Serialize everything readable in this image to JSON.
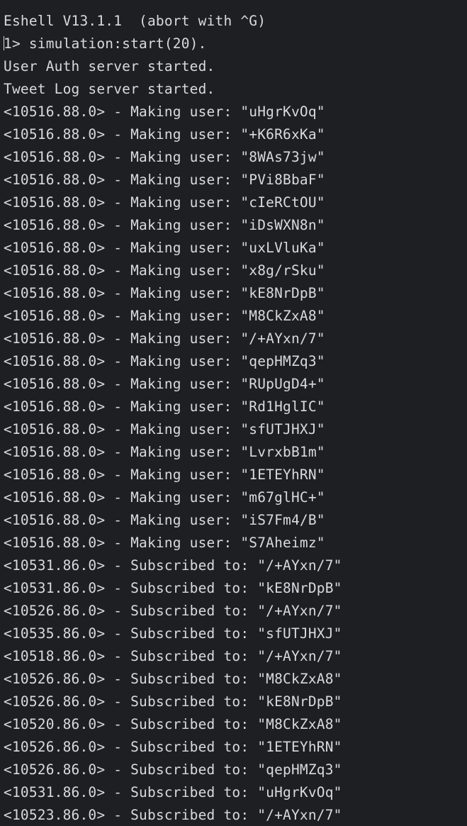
{
  "terminal": {
    "lines": [
      "Eshell V13.1.1  (abort with ^G)",
      "1> simulation:start(20).",
      "User Auth server started.",
      "Tweet Log server started.",
      "<10516.88.0> - Making user: \"uHgrKvOq\"",
      "<10516.88.0> - Making user: \"+K6R6xKa\"",
      "<10516.88.0> - Making user: \"8WAs73jw\"",
      "<10516.88.0> - Making user: \"PVi8BbaF\"",
      "<10516.88.0> - Making user: \"cIeRCtOU\"",
      "<10516.88.0> - Making user: \"iDsWXN8n\"",
      "<10516.88.0> - Making user: \"uxLVluKa\"",
      "<10516.88.0> - Making user: \"x8g/rSku\"",
      "<10516.88.0> - Making user: \"kE8NrDpB\"",
      "<10516.88.0> - Making user: \"M8CkZxA8\"",
      "<10516.88.0> - Making user: \"/+AYxn/7\"",
      "<10516.88.0> - Making user: \"qepHMZq3\"",
      "<10516.88.0> - Making user: \"RUpUgD4+\"",
      "<10516.88.0> - Making user: \"Rd1HglIC\"",
      "<10516.88.0> - Making user: \"sfUTJHXJ\"",
      "<10516.88.0> - Making user: \"LvrxbB1m\"",
      "<10516.88.0> - Making user: \"1ETEYhRN\"",
      "<10516.88.0> - Making user: \"m67glHC+\"",
      "<10516.88.0> - Making user: \"iS7Fm4/B\"",
      "<10516.88.0> - Making user: \"S7Aheimz\"",
      "<10531.86.0> - Subscribed to: \"/+AYxn/7\"",
      "<10531.86.0> - Subscribed to: \"kE8NrDpB\"",
      "<10526.86.0> - Subscribed to: \"/+AYxn/7\"",
      "<10535.86.0> - Subscribed to: \"sfUTJHXJ\"",
      "<10518.86.0> - Subscribed to: \"/+AYxn/7\"",
      "<10526.86.0> - Subscribed to: \"M8CkZxA8\"",
      "<10526.86.0> - Subscribed to: \"kE8NrDpB\"",
      "<10520.86.0> - Subscribed to: \"M8CkZxA8\"",
      "<10526.86.0> - Subscribed to: \"1ETEYhRN\"",
      "<10526.86.0> - Subscribed to: \"qepHMZq3\"",
      "<10531.86.0> - Subscribed to: \"uHgrKvOq\"",
      "<10523.86.0> - Subscribed to: \"/+AYxn/7\""
    ]
  },
  "colors": {
    "background": "#1e1f22",
    "text": "#d7dae0"
  }
}
